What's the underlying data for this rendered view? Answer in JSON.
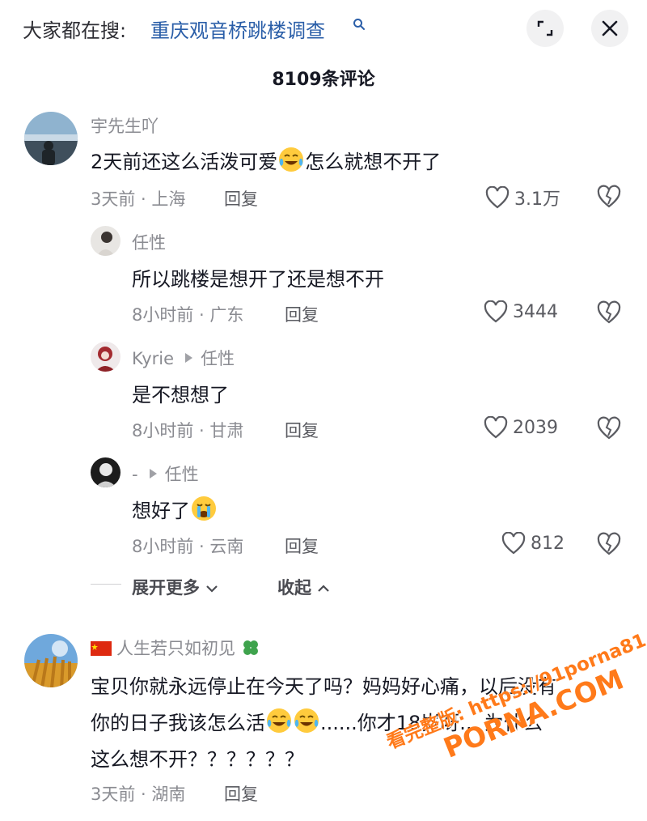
{
  "search": {
    "prefix": "大家都在搜:",
    "term": "重庆观音桥跳楼调查"
  },
  "comment_count": "8109条评论",
  "comments": [
    {
      "username": "宇先生吖",
      "text_before": "2天前还这么活泼可爱",
      "text_after": "怎么就想不开了",
      "meta": "3天前 · 上海",
      "reply": "回复",
      "likes": "3.1万"
    }
  ],
  "replies": [
    {
      "username": "任性",
      "text": "所以跳楼是想开了还是想不开",
      "meta": "8小时前 · 广东",
      "reply": "回复",
      "likes": "3444"
    },
    {
      "username": "Kyrie",
      "reply_to": "任性",
      "text": "是不想想了",
      "meta": "8小时前 · 甘肃",
      "reply": "回复",
      "likes": "2039"
    },
    {
      "username": "-",
      "reply_to": "任性",
      "text": "想好了",
      "meta": "8小时前 · 云南",
      "reply": "回复",
      "likes": "812"
    }
  ],
  "thread_controls": {
    "expand_more": "展开更多",
    "collapse": "收起"
  },
  "comment2": {
    "username": "人生若只如初见",
    "text_line1": "宝贝你就永远停止在今天了吗？妈妈好心痛，以后没有",
    "text_line2a": "你的日子我该怎么活",
    "text_line2b": "......你才18岁呀... 为什么",
    "text_line3": "这么想不开？？？？？？",
    "meta": "3天前 · 湖南",
    "reply": "回复"
  },
  "watermark": {
    "logo": "PORNA.COM",
    "url": "看完整版: https://91porna81.com"
  },
  "colors": {
    "link_blue": "#2a5ea8",
    "muted": "#8a8b91",
    "watermark": "#ff7a1a"
  }
}
